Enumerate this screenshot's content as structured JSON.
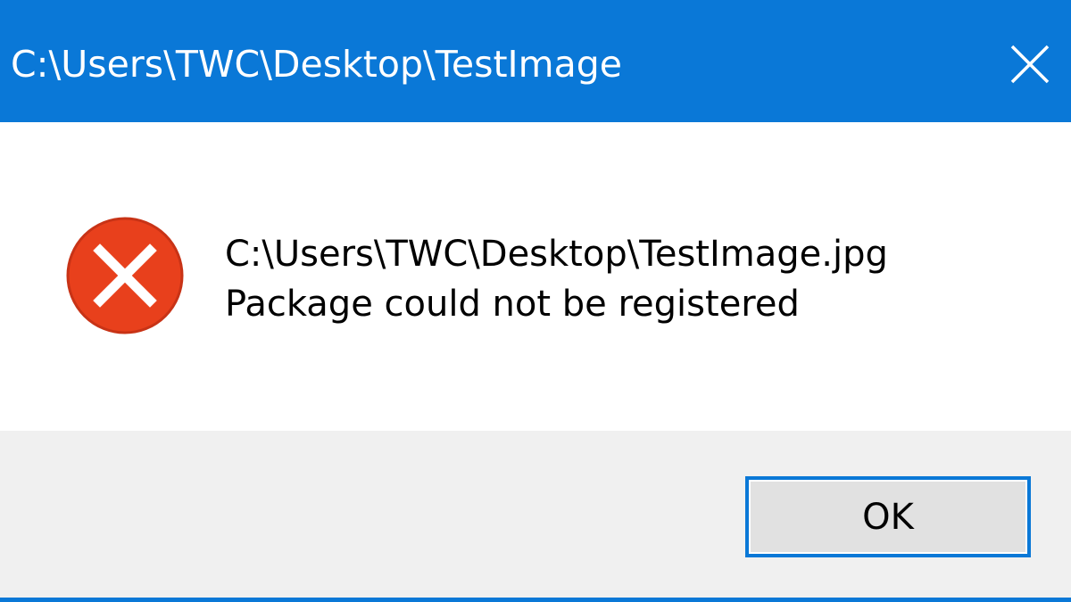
{
  "window": {
    "title": "C:\\Users\\TWC\\Desktop\\TestImage",
    "close_icon": "close-icon",
    "accent_color": "#0a78d7"
  },
  "message": {
    "icon": "error-icon",
    "icon_color": "#e8401c",
    "line1": "C:\\Users\\TWC\\Desktop\\TestImage.jpg",
    "line2": "Package could not be registered"
  },
  "footer": {
    "ok_label": "OK"
  }
}
